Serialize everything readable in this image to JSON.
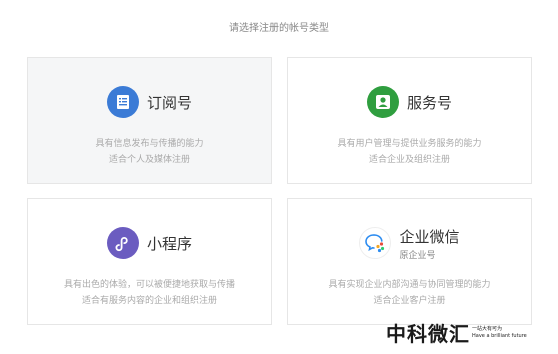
{
  "heading": "请选择注册的帐号类型",
  "cards": [
    {
      "title": "订阅号",
      "subtitle": "",
      "icon": "subscription-document-icon",
      "desc1": "具有信息发布与传播的能力",
      "desc2": "适合个人及媒体注册"
    },
    {
      "title": "服务号",
      "subtitle": "",
      "icon": "service-user-icon",
      "desc1": "具有用户管理与提供业务服务的能力",
      "desc2": "适合企业及组织注册"
    },
    {
      "title": "小程序",
      "subtitle": "",
      "icon": "mini-program-icon",
      "desc1": "具有出色的体验，可以被便捷地获取与传播",
      "desc2": "适合有服务内容的企业和组织注册"
    },
    {
      "title": "企业微信",
      "subtitle": "原企业号",
      "icon": "wecom-chat-icon",
      "desc1": "具有实现企业内部沟通与协同管理的能力",
      "desc2": "适合企业客户注册"
    }
  ],
  "watermark": {
    "brand": "中科微汇",
    "tagline": "一站大有可为",
    "tagline_en": "Have a brilliant future"
  },
  "colors": {
    "blue": "#3b7bd6",
    "green": "#2f9e3f",
    "purple": "#6b5cc0",
    "selected_bg": "#f5f6f7"
  }
}
